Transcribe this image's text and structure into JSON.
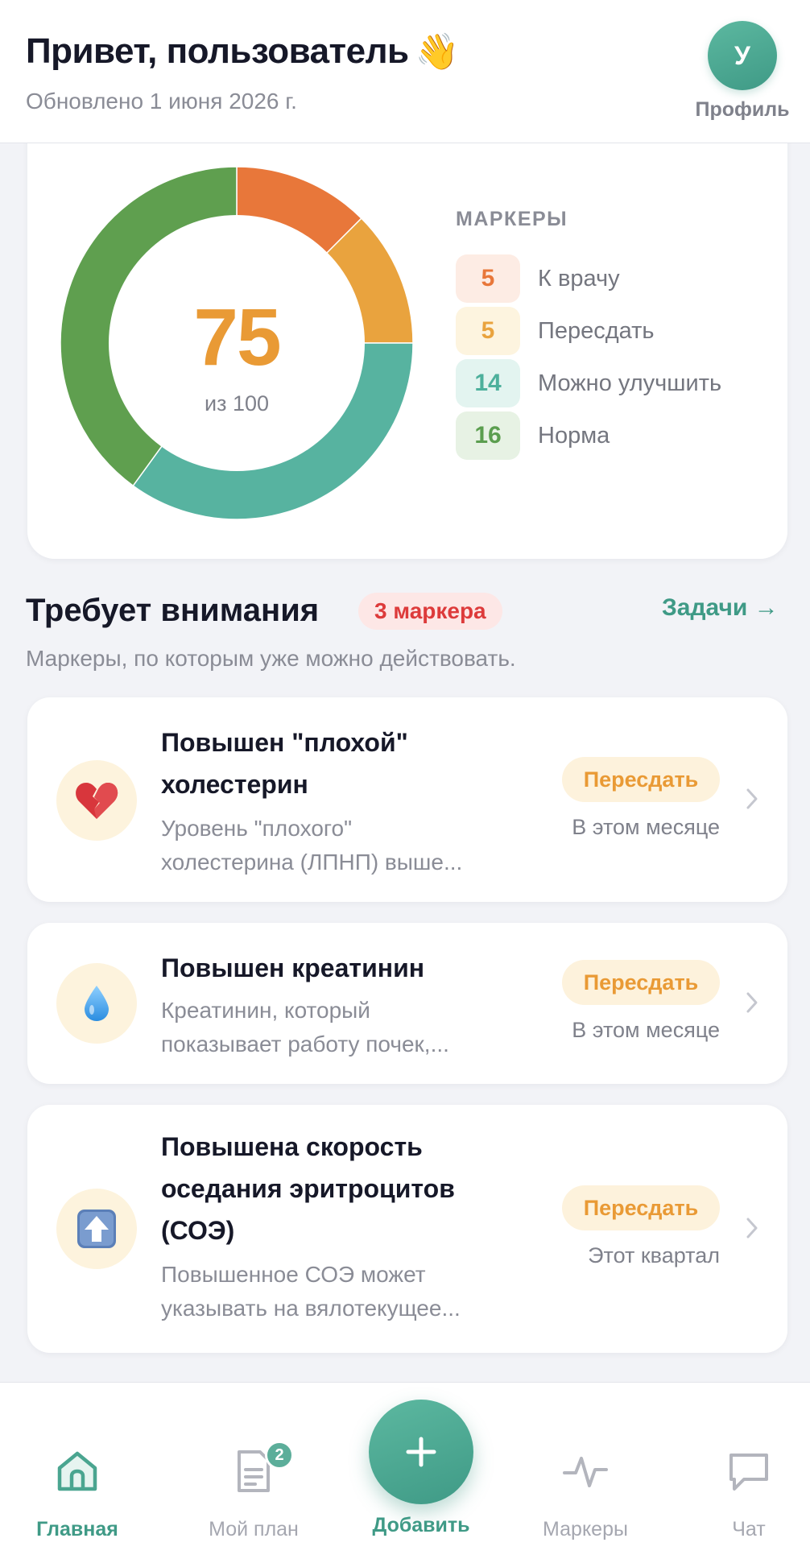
{
  "header": {
    "greeting": "Привет, пользователь",
    "greeting_emoji": "👋",
    "updated": "Обновлено 1 июня 2026 г.",
    "avatar_initial": "У",
    "profile_label": "Профиль"
  },
  "score": {
    "value": "75",
    "max_label": "из 100",
    "markers_title": "МАРКЕРЫ",
    "legend": [
      {
        "count": "5",
        "label": "К врачу",
        "color": "#e8773a",
        "bg": "#fdece4"
      },
      {
        "count": "5",
        "label": "Пересдать",
        "color": "#e9a33e",
        "bg": "#fdf4df"
      },
      {
        "count": "14",
        "label": "Можно улучшить",
        "color": "#4db09c",
        "bg": "#e3f4f0"
      },
      {
        "count": "16",
        "label": "Норма",
        "color": "#5b9e4f",
        "bg": "#e7f2e4"
      }
    ]
  },
  "chart_data": {
    "type": "pie",
    "categories": [
      "К врачу",
      "Пересдать",
      "Можно улучшить",
      "Норма"
    ],
    "values": [
      5,
      5,
      14,
      16
    ],
    "colors": [
      "#e8773a",
      "#e9a33e",
      "#57b3a0",
      "#5f9f4f"
    ]
  },
  "attention": {
    "title": "Требует внимания",
    "badge": "3 маркера",
    "tasks_link": "Задачи →",
    "subtitle": "Маркеры, по которым уже можно действовать.",
    "cards": [
      {
        "icon": "broken-heart-icon",
        "emoji": "💔",
        "title": "Повышен \"плохой\" холестерин",
        "desc1": "Уровень \"плохого\"",
        "desc2": "холестерина (ЛПНП) выше...",
        "badge": "Пересдать",
        "when": "В этом месяце"
      },
      {
        "icon": "droplet-icon",
        "emoji": "💧",
        "title": "Повышен креатинин",
        "desc1": "Креатинин, который",
        "desc2": "показывает работу почек,...",
        "badge": "Пересдать",
        "when": "В этом месяце"
      },
      {
        "icon": "up-arrow-icon",
        "emoji": "⬆️",
        "title": "Повышена скорость оседания эритроцитов (СОЭ)",
        "desc1": "Повышенное СОЭ может",
        "desc2": "указывать на вялотекущее...",
        "badge": "Пересдать",
        "when": "Этот квартал"
      }
    ]
  },
  "nav": {
    "home": "Главная",
    "plan": "Мой план",
    "plan_badge": "2",
    "add": "Добавить",
    "markers": "Маркеры",
    "chat": "Чат"
  }
}
